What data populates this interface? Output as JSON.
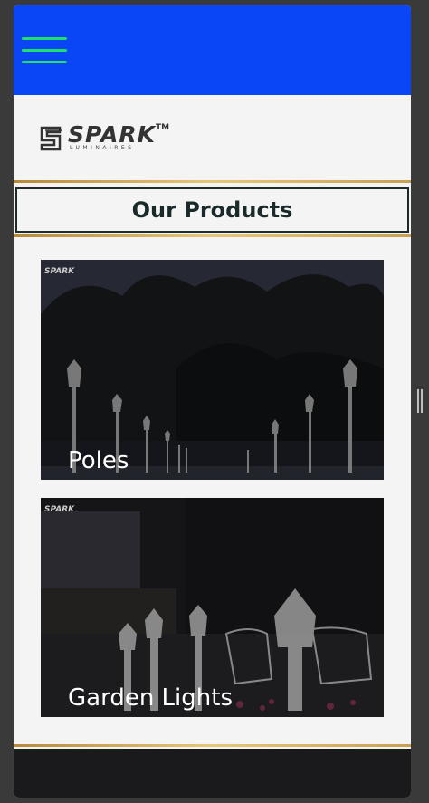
{
  "header": {
    "menu_icon": "hamburger-icon",
    "accent_color": "#0a46f5",
    "menu_color": "#1fe06a"
  },
  "brand": {
    "name": "SPARK",
    "trademark": "TM",
    "tagline": "LUMINAIRES"
  },
  "section": {
    "title": "Our Products"
  },
  "products": [
    {
      "label": "Poles",
      "image_brand": "SPARK"
    },
    {
      "label": "Garden Lights",
      "image_brand": "SPARK"
    }
  ]
}
